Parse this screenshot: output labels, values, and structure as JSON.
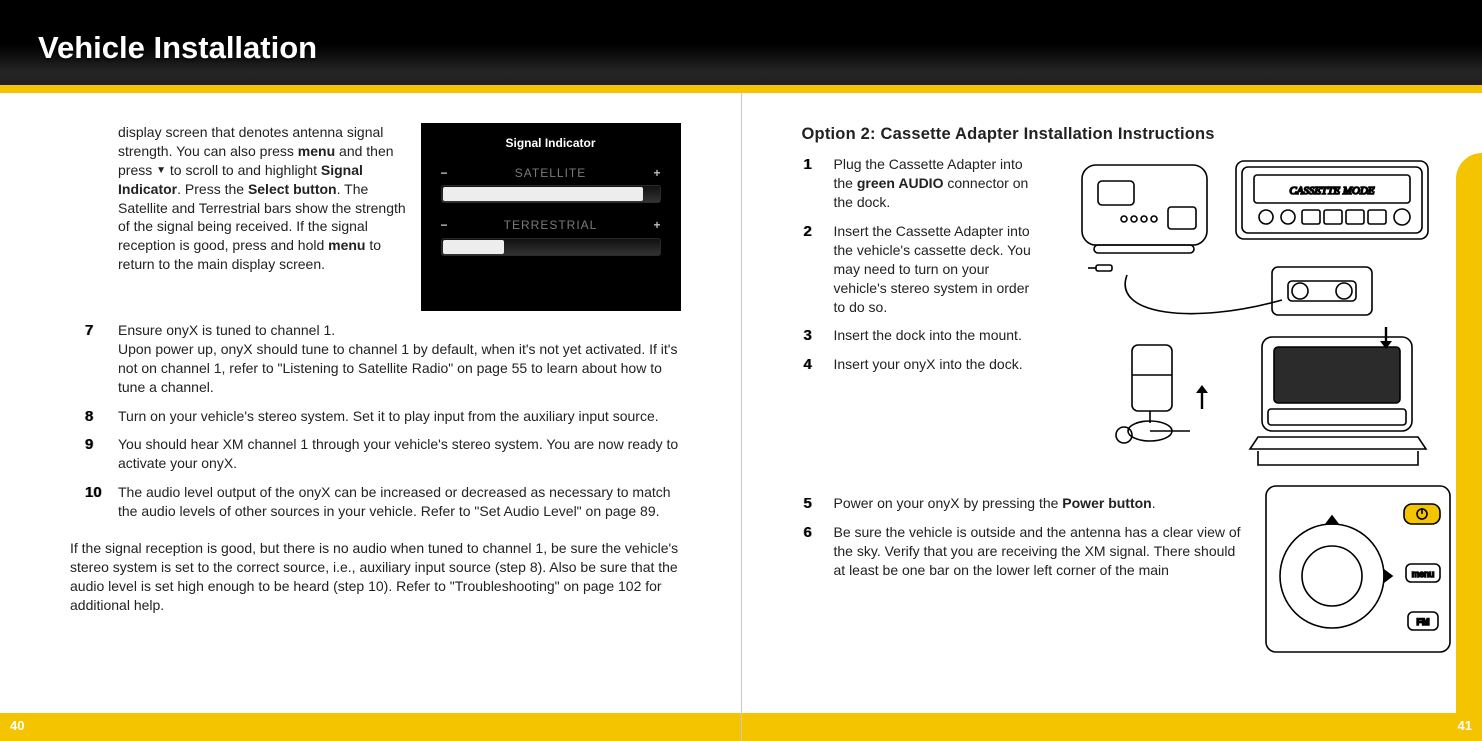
{
  "title": "Vehicle Installation",
  "left": {
    "introHtml": "display screen that denotes antenna signal strength. You can also press <b>menu</b> and then press <span class='down-tri'></span> to scroll to and highlight <b>Signal Indicator</b>. Press the <b>Select button</b>. The Satellite and Terrestrial bars show the strength of the signal being received. If the signal reception is good, press and hold <b>menu</b> to return to the main display screen.",
    "signal": {
      "title": "Signal Indicator",
      "row1": {
        "label": "SATELLITE",
        "minus": "−",
        "plus": "+",
        "fillPct": 92
      },
      "row2": {
        "label": "TERRESTRIAL",
        "minus": "−",
        "plus": "+",
        "fillPct": 28
      }
    },
    "steps": [
      {
        "num": "7",
        "html": "Ensure onyX is tuned to channel 1.<br>Upon power up, onyX should tune to channel 1 by default, when it's not yet activated. If it's not on channel 1, refer to \"Listening to Satellite Radio\" on page 55 to learn about how to tune a channel."
      },
      {
        "num": "8",
        "html": "Turn on your vehicle's stereo system. Set it to play input from the auxiliary input source."
      },
      {
        "num": "9",
        "html": "You should hear XM channel 1 through your vehicle's stereo system. You are now ready to activate your onyX."
      },
      {
        "num": "10",
        "html": "The audio level output of the onyX can be increased or decreased as necessary to match the audio levels of other sources in your vehicle. Refer to \"Set Audio Level\" on page 89."
      }
    ],
    "footnote": "If the signal reception is good, but there is no audio when tuned to channel 1, be sure the vehicle's stereo system is set to the correct source, i.e., auxiliary input source (step 8). Also be sure that the audio level is set high enough to be heard (step 10). Refer to \"Troubleshooting\" on page 102 for additional help.",
    "pageNum": "40"
  },
  "right": {
    "heading": "Option 2: Cassette Adapter Installation Instructions",
    "stepsA": [
      {
        "num": "1",
        "html": "Plug the Cassette Adapter into the <b>green AUDIO</b> connector on the dock."
      },
      {
        "num": "2",
        "html": "Insert the Cassette Adapter into the vehicle's cassette deck. You may need to turn on your vehicle's stereo system in order to do so."
      },
      {
        "num": "3",
        "html": "Insert the dock into the mount."
      },
      {
        "num": "4",
        "html": "Insert your onyX into the dock."
      }
    ],
    "stepsB": [
      {
        "num": "5",
        "html": "Power on your onyX by pressing the <b>Power button</b>."
      },
      {
        "num": "6",
        "html": "Be sure the vehicle is outside and the antenna has a clear view of the sky. Verify that you are receiving the XM signal. There should at least be one bar on the lower left corner of the main"
      }
    ],
    "cassetteLabel": "CASSETTE MODE",
    "pageNum": "41"
  }
}
